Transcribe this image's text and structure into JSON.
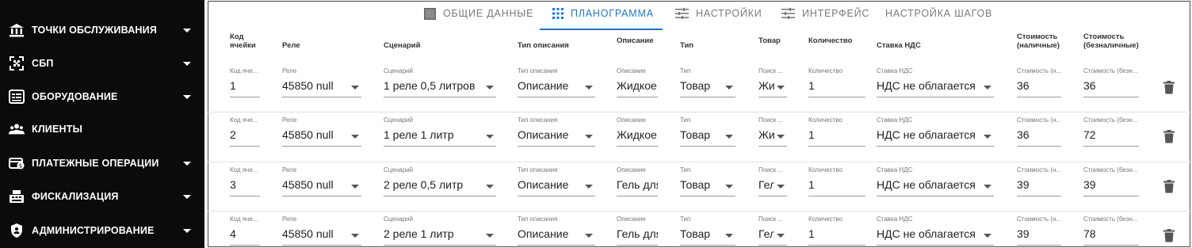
{
  "sidebar": {
    "items": [
      {
        "label": "ТОЧКИ ОБСЛУЖИВАНИЯ",
        "icon": "bank-icon",
        "expandable": true
      },
      {
        "label": "СБП",
        "icon": "qr-code-icon",
        "expandable": true
      },
      {
        "label": "ОБОРУДОВАНИЕ",
        "icon": "device-icon",
        "expandable": true
      },
      {
        "label": "КЛИЕНТЫ",
        "icon": "people-icon",
        "expandable": false
      },
      {
        "label": "ПЛАТЕЖНЫЕ ОПЕРАЦИИ",
        "icon": "payment-icon",
        "expandable": true
      },
      {
        "label": "ФИСКАЛИЗАЦИЯ",
        "icon": "register-icon",
        "expandable": true
      },
      {
        "label": "АДМИНИСТРИРОВАНИЕ",
        "icon": "shield-icon",
        "expandable": true
      }
    ]
  },
  "tabs": [
    {
      "label": "ОБЩИЕ ДАННЫЕ",
      "icon": "square-icon",
      "active": false
    },
    {
      "label": "ПЛАНОГРАММА",
      "icon": "grid-dots-icon",
      "active": true
    },
    {
      "label": "НАСТРОЙКИ",
      "icon": "tune-icon",
      "active": false
    },
    {
      "label": "ИНТЕРФЕЙС",
      "icon": "tune-icon",
      "active": false
    },
    {
      "label": "НАСТРОЙКА ШАГОВ",
      "icon": "",
      "active": false
    }
  ],
  "columns": {
    "cell": "Код ячейки",
    "relay": "Реле",
    "scenario": "Сценарий",
    "desc_type": "Тип описания",
    "desc": "Описание",
    "type": "Тип",
    "product": "Товар",
    "qty": "Количество",
    "vat": "Ставка НДС",
    "cost_cash": "Стоимость (наличные)",
    "cost_card": "Стоимость (безналичные)"
  },
  "field_labels": {
    "cell": "Код яче...",
    "relay": "Реле",
    "scenario": "Сценарий",
    "desc_type": "Тип описания",
    "desc": "Описание",
    "type": "Тип",
    "product": "Поиск ...",
    "qty": "Количество",
    "vat": "Ставка НДС",
    "cost_cash": "Стоимость (н...",
    "cost_card": "Стоимость (безн..."
  },
  "rows": [
    {
      "cell": "1",
      "relay": "45850 null",
      "scenario": "1 реле 0,5 литров",
      "desc_type": "Описание",
      "desc": "Жидкое мыло",
      "type": "Товар",
      "product": "Жидкое",
      "qty": "1",
      "vat": "НДС не облагается",
      "cost_cash": "36",
      "cost_card": "36"
    },
    {
      "cell": "2",
      "relay": "45850 null",
      "scenario": "1 реле 1 литр",
      "desc_type": "Описание",
      "desc": "Жидкое мыло",
      "type": "Товар",
      "product": "Жидкое",
      "qty": "1",
      "vat": "НДС не облагается",
      "cost_cash": "36",
      "cost_card": "72"
    },
    {
      "cell": "3",
      "relay": "45850 null",
      "scenario": "2 реле 0,5 литр",
      "desc_type": "Описание",
      "desc": "Гель для душа",
      "type": "Товар",
      "product": "Гель",
      "qty": "1",
      "vat": "НДС не облагается",
      "cost_cash": "39",
      "cost_card": "39"
    },
    {
      "cell": "4",
      "relay": "45850 null",
      "scenario": "2 реле 1 литр",
      "desc_type": "Описание",
      "desc": "Гель для душа",
      "type": "Товар",
      "product": "Гель",
      "qty": "1",
      "vat": "НДС не облагается",
      "cost_cash": "39",
      "cost_card": "78"
    }
  ]
}
